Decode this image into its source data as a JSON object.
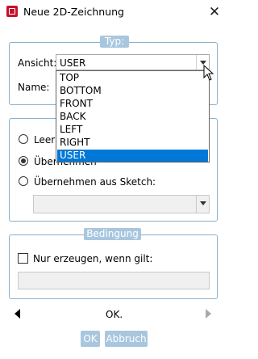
{
  "window": {
    "title": "Neue 2D-Zeichnung",
    "close_label": "✕"
  },
  "typ_group": {
    "legend": "Typ:",
    "ansicht_label": "Ansicht:",
    "ansicht_value": "USER",
    "name_label": "Name:",
    "dropdown_options": [
      "TOP",
      "BOTTOM",
      "FRONT",
      "BACK",
      "LEFT",
      "RIGHT",
      "USER"
    ],
    "selected_option": "USER"
  },
  "source_group": {
    "radio_options": [
      {
        "label": "Leer",
        "checked": false
      },
      {
        "label": "Übernehmen",
        "checked": true
      },
      {
        "label": "Übernehmen aus Sketch:",
        "checked": false
      }
    ]
  },
  "bedingung_group": {
    "legend": "Bedingung",
    "checkbox_label": "Nur erzeugen, wenn gilt:",
    "checkbox_checked": false
  },
  "nav": {
    "center_label": "OK."
  },
  "buttons": {
    "ok": "OK",
    "cancel": "Abbruch"
  },
  "colors": {
    "accent": "#a8c7de",
    "border": "#8ab0cc",
    "selection": "#0078d7",
    "brand_icon": "#c8102e"
  }
}
